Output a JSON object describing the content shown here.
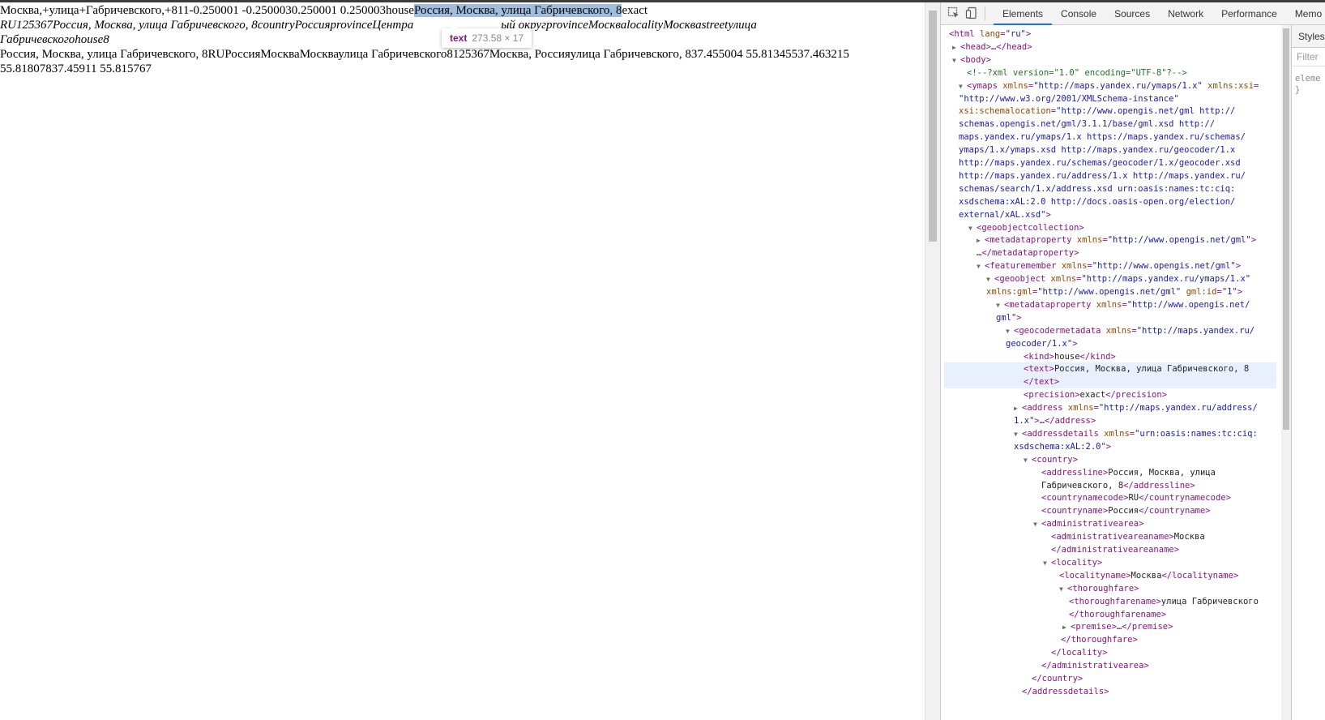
{
  "page": {
    "line1_prefix": "Москва,+улица+Габричевского,+811-0.250001 -0.2500030.250001 0.250003house",
    "line1_selected": "Россия, Москва, улица Габричевского, 8",
    "line1_suffix": "exact",
    "line2_italic_a": "RU125367Россия, Москва, улица Габричевского, 8countryРоссияprovinceЦентра",
    "line2_italic_b": "ый округprovinceМоскваlocalityМоскваstreetулица",
    "line3_italic": "Габричевскогоhouse8",
    "line4": "Россия, Москва, улица Габричевского, 8RUРоссияМоскваМоскваулица Габричевского8125367Москва, Россияулица Габричевского, 837.455004 55.81345537.463215",
    "line5": "55.81807837.45911 55.815767"
  },
  "tooltip": {
    "tag": "text",
    "dims": "273.58 × 17"
  },
  "devtools": {
    "tabs": [
      "Elements",
      "Console",
      "Sources",
      "Network",
      "Performance",
      "Memo"
    ],
    "active_tab": "Elements",
    "styles_tab": "Styles",
    "filter_placeholder": "Filter",
    "style_rule_line1": "eleme",
    "style_rule_line2": "}",
    "tree": [
      {
        "parts": [
          [
            "tag",
            "<html "
          ],
          [
            "attr",
            "lang"
          ],
          [
            "tag",
            "="
          ],
          [
            "val",
            "\"ru\""
          ],
          [
            "tag",
            ">"
          ]
        ]
      },
      {
        "arrow": "▶",
        "parts": [
          [
            "tag",
            "<head>"
          ],
          [
            "txt",
            "…"
          ],
          [
            "tag",
            "</head>"
          ]
        ]
      },
      {
        "arrow": "▼",
        "parts": [
          [
            "tag",
            "<body>"
          ]
        ]
      },
      {
        "parts": [
          [
            "cm",
            "<!--?xml version=\"1.0\" encoding=\"UTF-8\"?-->"
          ]
        ]
      },
      {
        "arrow": "▼",
        "parts": [
          [
            "tag",
            "<ymaps "
          ],
          [
            "attr",
            "xmlns"
          ],
          [
            "tag",
            "="
          ],
          [
            "val",
            "\"http://maps.yandex.ru/ymaps/1.x\""
          ],
          [
            "attr",
            " xmlns:xsi"
          ],
          [
            "tag",
            "="
          ]
        ]
      },
      {
        "parts": [
          [
            "val",
            "\"http://www.w3.org/2001/XMLSchema-instance\""
          ]
        ]
      },
      {
        "parts": [
          [
            "attr",
            "xsi:schemalocation"
          ],
          [
            "tag",
            "="
          ],
          [
            "val",
            "\"http://www.opengis.net/gml http://"
          ]
        ]
      },
      {
        "parts": [
          [
            "val",
            "schemas.opengis.net/gml/3.1.1/base/gml.xsd http://"
          ]
        ]
      },
      {
        "parts": [
          [
            "val",
            "maps.yandex.ru/ymaps/1.x https://maps.yandex.ru/schemas/"
          ]
        ]
      },
      {
        "parts": [
          [
            "val",
            "ymaps/1.x/ymaps.xsd http://maps.yandex.ru/geocoder/1.x"
          ]
        ]
      },
      {
        "parts": [
          [
            "val",
            "http://maps.yandex.ru/schemas/geocoder/1.x/geocoder.xsd"
          ]
        ]
      },
      {
        "parts": [
          [
            "val",
            "http://maps.yandex.ru/address/1.x http://maps.yandex.ru/"
          ]
        ]
      },
      {
        "parts": [
          [
            "val",
            "schemas/search/1.x/address.xsd urn:oasis:names:tc:ciq:"
          ]
        ]
      },
      {
        "parts": [
          [
            "val",
            "xsdschema:xAL:2.0 http://docs.oasis-open.org/election/"
          ]
        ]
      },
      {
        "parts": [
          [
            "val",
            "external/xAL.xsd\""
          ],
          [
            "tag",
            ">"
          ]
        ]
      },
      {
        "arrow": "▼",
        "parts": [
          [
            "tag",
            "<geoobjectcollection>"
          ]
        ]
      },
      {
        "arrow": "▶",
        "parts": [
          [
            "tag",
            "<metadataproperty "
          ],
          [
            "attr",
            "xmlns"
          ],
          [
            "tag",
            "="
          ],
          [
            "val",
            "\"http://www.opengis.net/gml\""
          ],
          [
            "tag",
            ">"
          ]
        ]
      },
      {
        "parts": [
          [
            "txt",
            "…"
          ],
          [
            "tag",
            "</metadataproperty>"
          ]
        ]
      },
      {
        "arrow": "▼",
        "parts": [
          [
            "tag",
            "<featuremember "
          ],
          [
            "attr",
            "xmlns"
          ],
          [
            "tag",
            "="
          ],
          [
            "val",
            "\"http://www.opengis.net/gml\""
          ],
          [
            "tag",
            ">"
          ]
        ]
      },
      {
        "arrow": "▼",
        "parts": [
          [
            "tag",
            "<geoobject "
          ],
          [
            "attr",
            "xmlns"
          ],
          [
            "tag",
            "="
          ],
          [
            "val",
            "\"http://maps.yandex.ru/ymaps/1.x\""
          ]
        ]
      },
      {
        "parts": [
          [
            "attr",
            "xmlns:gml"
          ],
          [
            "tag",
            "="
          ],
          [
            "val",
            "\"http://www.opengis.net/gml\""
          ],
          [
            "attr",
            " gml:id"
          ],
          [
            "tag",
            "="
          ],
          [
            "val",
            "\"1\""
          ],
          [
            "tag",
            ">"
          ]
        ]
      },
      {
        "arrow": "▼",
        "parts": [
          [
            "tag",
            "<metadataproperty "
          ],
          [
            "attr",
            "xmlns"
          ],
          [
            "tag",
            "="
          ],
          [
            "val",
            "\"http://www.opengis.net/"
          ]
        ]
      },
      {
        "parts": [
          [
            "val",
            "gml\""
          ],
          [
            "tag",
            ">"
          ]
        ]
      },
      {
        "arrow": "▼",
        "parts": [
          [
            "tag",
            "<geocodermetadata "
          ],
          [
            "attr",
            "xmlns"
          ],
          [
            "tag",
            "="
          ],
          [
            "val",
            "\"http://maps.yandex.ru/"
          ]
        ]
      },
      {
        "parts": [
          [
            "val",
            "geocoder/1.x\""
          ],
          [
            "tag",
            ">"
          ]
        ]
      },
      {
        "parts": [
          [
            "tag",
            "<kind>"
          ],
          [
            "txt",
            "house"
          ],
          [
            "tag",
            "</kind>"
          ]
        ]
      },
      {
        "selected": true,
        "parts": [
          [
            "tag",
            "<text>"
          ],
          [
            "txt",
            "Россия, Москва, улица Габричевского, 8"
          ]
        ]
      },
      {
        "selected": true,
        "parts": [
          [
            "tag",
            "</text>"
          ]
        ]
      },
      {
        "parts": [
          [
            "tag",
            "<precision>"
          ],
          [
            "txt",
            "exact"
          ],
          [
            "tag",
            "</precision>"
          ]
        ]
      },
      {
        "arrow": "▶",
        "parts": [
          [
            "tag",
            "<address "
          ],
          [
            "attr",
            "xmlns"
          ],
          [
            "tag",
            "="
          ],
          [
            "val",
            "\"http://maps.yandex.ru/address/"
          ]
        ]
      },
      {
        "parts": [
          [
            "val",
            "1.x\""
          ],
          [
            "tag",
            ">"
          ],
          [
            "txt",
            "…"
          ],
          [
            "tag",
            "</address>"
          ]
        ]
      },
      {
        "arrow": "▼",
        "parts": [
          [
            "tag",
            "<addressdetails "
          ],
          [
            "attr",
            "xmlns"
          ],
          [
            "tag",
            "="
          ],
          [
            "val",
            "\"urn:oasis:names:tc:ciq:"
          ]
        ]
      },
      {
        "parts": [
          [
            "val",
            "xsdschema:xAL:2.0\""
          ],
          [
            "tag",
            ">"
          ]
        ]
      },
      {
        "arrow": "▼",
        "parts": [
          [
            "tag",
            "<country>"
          ]
        ]
      },
      {
        "parts": [
          [
            "tag",
            "<addressline>"
          ],
          [
            "txt",
            "Россия, Москва, улица"
          ]
        ]
      },
      {
        "parts": [
          [
            "txt",
            "Габричевского, 8"
          ],
          [
            "tag",
            "</addressline>"
          ]
        ]
      },
      {
        "parts": [
          [
            "tag",
            "<countrynamecode>"
          ],
          [
            "txt",
            "RU"
          ],
          [
            "tag",
            "</countrynamecode>"
          ]
        ]
      },
      {
        "parts": [
          [
            "tag",
            "<countryname>"
          ],
          [
            "txt",
            "Россия"
          ],
          [
            "tag",
            "</countryname>"
          ]
        ]
      },
      {
        "arrow": "▼",
        "parts": [
          [
            "tag",
            "<administrativearea>"
          ]
        ]
      },
      {
        "parts": [
          [
            "tag",
            "<administrativeareaname>"
          ],
          [
            "txt",
            "Москва"
          ]
        ]
      },
      {
        "parts": [
          [
            "tag",
            "</administrativeareaname>"
          ]
        ]
      },
      {
        "arrow": "▼",
        "parts": [
          [
            "tag",
            "<locality>"
          ]
        ]
      },
      {
        "parts": [
          [
            "tag",
            "<localityname>"
          ],
          [
            "txt",
            "Москва"
          ],
          [
            "tag",
            "</localityname>"
          ]
        ]
      },
      {
        "arrow": "▼",
        "parts": [
          [
            "tag",
            "<thoroughfare>"
          ]
        ]
      },
      {
        "parts": [
          [
            "tag",
            "<thoroughfarename>"
          ],
          [
            "txt",
            "улица Габричевского"
          ]
        ]
      },
      {
        "parts": [
          [
            "tag",
            "</thoroughfarename>"
          ]
        ]
      },
      {
        "arrow": "▶",
        "parts": [
          [
            "tag",
            "<premise>"
          ],
          [
            "txt",
            "…"
          ],
          [
            "tag",
            "</premise>"
          ]
        ]
      },
      {
        "parts": [
          [
            "tag",
            "</thoroughfare>"
          ]
        ]
      },
      {
        "parts": [
          [
            "tag",
            "</locality>"
          ]
        ]
      },
      {
        "parts": [
          [
            "tag",
            "</administrativearea>"
          ]
        ]
      },
      {
        "parts": [
          [
            "tag",
            "</country>"
          ]
        ]
      },
      {
        "parts": [
          [
            "tag",
            "</addressdetails>"
          ]
        ]
      }
    ]
  }
}
